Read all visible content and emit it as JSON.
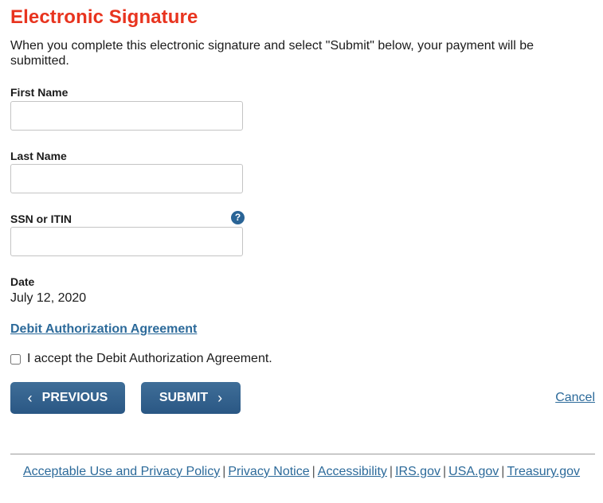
{
  "page": {
    "title": "Electronic Signature",
    "intro": "When you complete this electronic signature and select \"Submit\" below, your payment will be submitted."
  },
  "form": {
    "first_name": {
      "label": "First Name",
      "value": "",
      "placeholder": ""
    },
    "last_name": {
      "label": "Last Name",
      "value": "",
      "placeholder": ""
    },
    "ssn_itin": {
      "label": "SSN or ITIN",
      "value": "",
      "placeholder": "",
      "help_icon": "?"
    },
    "date": {
      "label": "Date",
      "value": "July 12, 2020"
    },
    "agreement_link": "Debit Authorization Agreement",
    "accept_checkbox": {
      "label": "I accept the Debit Authorization Agreement.",
      "checked": false
    }
  },
  "actions": {
    "previous_label": "PREVIOUS",
    "previous_icon": "‹",
    "submit_label": "SUBMIT",
    "submit_icon": "›",
    "cancel_label": "Cancel"
  },
  "footer": {
    "links": [
      "Acceptable Use and Privacy Policy",
      "Privacy Notice",
      "Accessibility",
      "IRS.gov",
      "USA.gov",
      "Treasury.gov"
    ],
    "separator": "|"
  },
  "colors": {
    "title": "#e8341f",
    "link": "#2c6a9a",
    "button": "#2f5e8a"
  }
}
